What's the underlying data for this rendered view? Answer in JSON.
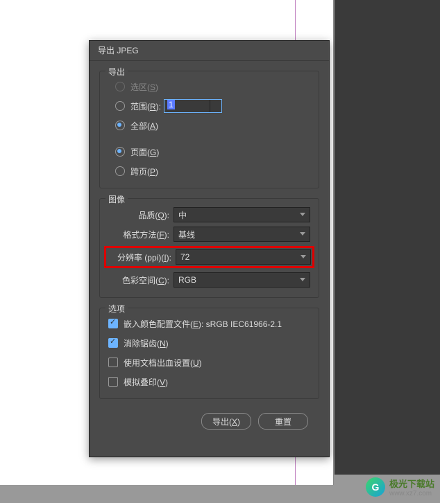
{
  "dialog": {
    "title": "导出 JPEG",
    "export_group": {
      "legend": "导出",
      "selection_label": "选区(<u>S</u>)",
      "range_label": "范围(<u>R</u>):",
      "range_value": "1",
      "all_label": "全部(<u>A</u>)",
      "pages_label": "页面(<u>G</u>)",
      "spreads_label": "跨页(<u>P</u>)"
    },
    "image_group": {
      "legend": "图像",
      "quality_label": "品质(<u>Q</u>):",
      "quality_value": "中",
      "format_label": "格式方法(<u>F</u>):",
      "format_value": "基线",
      "resolution_label": "分辨率 (ppi)(<u>I</u>):",
      "resolution_value": "72",
      "colorspace_label": "色彩空间(<u>C</u>):",
      "colorspace_value": "RGB"
    },
    "options_group": {
      "legend": "选项",
      "embed_profile_label": "嵌入颜色配置文件(<u>E</u>): sRGB IEC61966-2.1",
      "antialias_label": "消除锯齿(<u>N</u>)",
      "bleed_label": "使用文档出血设置(<u>U</u>)",
      "overprint_label": "模拟叠印(<u>V</u>)"
    },
    "export_btn": "导出(<u>X</u>)",
    "reset_btn": "重置"
  },
  "watermark": {
    "site_cn": "极光下载站",
    "site_url": "www.xz7.com"
  }
}
